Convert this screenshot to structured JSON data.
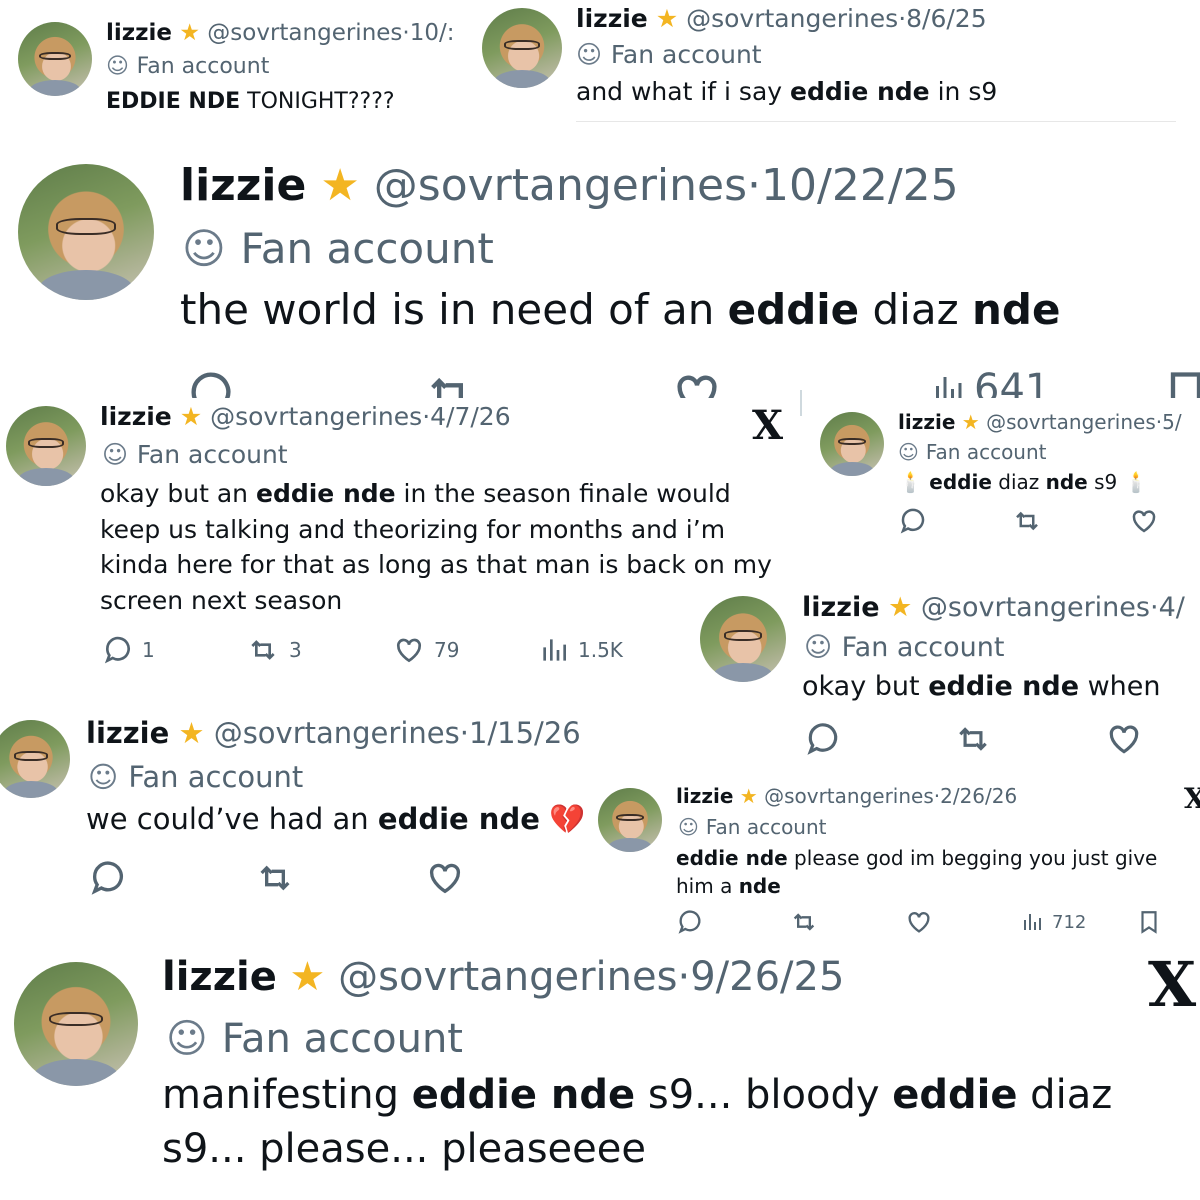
{
  "tweets": [
    {
      "name": "lizzie",
      "handle": "@sovrtangerines",
      "sep": "·",
      "date": "10/:",
      "badge": "Fan account",
      "body": [
        {
          "b": "EDDIE NDE"
        },
        {
          "t": " TONIGHT????"
        }
      ]
    },
    {
      "name": "lizzie",
      "handle": "@sovrtangerines",
      "sep": "·",
      "date": "8/6/25",
      "badge": "Fan account",
      "body": [
        {
          "t": "and what if i say "
        },
        {
          "b": "eddie nde"
        },
        {
          "t": " in s9"
        }
      ]
    },
    {
      "name": "lizzie",
      "handle": "@sovrtangerines",
      "sep": "·",
      "date": "10/22/25",
      "badge": "Fan account",
      "body": [
        {
          "t": "the world is in need of an "
        },
        {
          "b": "eddie"
        },
        {
          "t": " diaz "
        },
        {
          "b": "nde"
        }
      ],
      "views": "641"
    },
    {
      "name": "lizzie",
      "handle": "@sovrtangerines",
      "sep": "·",
      "date": "4/7/26",
      "badge": "Fan account",
      "body": [
        {
          "t": "okay but an "
        },
        {
          "b": "eddie nde"
        },
        {
          "t": " in the season finale would keep us talking and theorizing for months and i’m kinda here for that as long as that man is back on my screen next season"
        }
      ],
      "replies": "1",
      "reposts": "3",
      "likes": "79",
      "views": "1.5K"
    },
    {
      "name": "lizzie",
      "handle": "@sovrtangerines",
      "sep": "·",
      "date": "5/",
      "badge": "Fan account",
      "body": [
        {
          "t": "🕯️ "
        },
        {
          "b": "eddie"
        },
        {
          "t": " diaz "
        },
        {
          "b": "nde"
        },
        {
          "t": " s9 🕯️"
        }
      ]
    },
    {
      "name": "lizzie",
      "handle": "@sovrtangerines",
      "sep": "·",
      "date": "4/",
      "badge": "Fan account",
      "body": [
        {
          "t": "okay but "
        },
        {
          "b": "eddie nde"
        },
        {
          "t": " when"
        }
      ]
    },
    {
      "name": "lizzie",
      "handle": "@sovrtangerines",
      "sep": "·",
      "date": "1/15/26",
      "badge": "Fan account",
      "body": [
        {
          "t": "we could’ve had an "
        },
        {
          "b": "eddie nde"
        },
        {
          "t": " 💔"
        }
      ]
    },
    {
      "name": "lizzie",
      "handle": "@sovrtangerines",
      "sep": "·",
      "date": "2/26/26",
      "badge": "Fan account",
      "body": [
        {
          "b": "eddie nde"
        },
        {
          "t": " please god im begging you just give him a "
        },
        {
          "b": "nde"
        }
      ],
      "views": "712"
    },
    {
      "name": "lizzie",
      "handle": "@sovrtangerines",
      "sep": "·",
      "date": "9/26/25",
      "badge": "Fan account",
      "body": [
        {
          "t": "manifesting "
        },
        {
          "b": "eddie nde"
        },
        {
          "t": " s9... bloody "
        },
        {
          "b": "eddie"
        },
        {
          "t": " diaz s9... please... pleaseeee"
        }
      ]
    }
  ],
  "icons": {
    "star": "glowing-star-icon",
    "mask": "theater-mask-icon",
    "x": "x-logo-icon"
  },
  "x_logo": "X",
  "colors": {
    "text": "#0f1419",
    "muted": "#536471",
    "star": "#f3b522"
  }
}
